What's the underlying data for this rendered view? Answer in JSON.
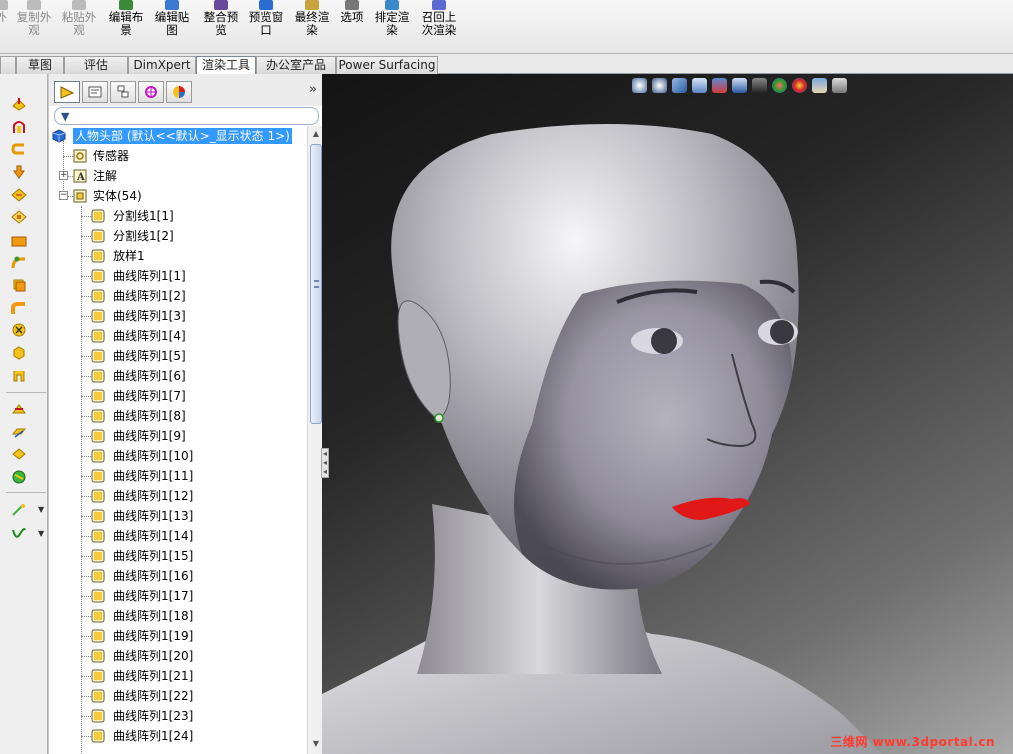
{
  "ribbon": {
    "buttons": [
      {
        "label": "外",
        "disabled": true,
        "icon": "edge-icon"
      },
      {
        "label": "复制外\n观",
        "disabled": true,
        "icon": "copy-appearance-icon"
      },
      {
        "label": "粘贴外\n观",
        "disabled": true,
        "icon": "paste-appearance-icon"
      },
      {
        "label": "编辑布\n景",
        "disabled": false,
        "icon": "edit-scene-icon"
      },
      {
        "label": "编辑贴\n图",
        "disabled": false,
        "icon": "edit-decal-icon"
      },
      {
        "label": "整合预\n览",
        "disabled": false,
        "icon": "integrated-preview-icon"
      },
      {
        "label": "预览窗\n口",
        "disabled": false,
        "icon": "preview-window-icon"
      },
      {
        "label": "最终渲\n染",
        "disabled": false,
        "icon": "final-render-icon"
      },
      {
        "label": "选项",
        "disabled": false,
        "icon": "options-icon"
      },
      {
        "label": "排定渲\n染",
        "disabled": false,
        "icon": "schedule-render-icon"
      },
      {
        "label": "召回上\n次渲染",
        "disabled": false,
        "icon": "recall-render-icon"
      }
    ]
  },
  "tabs": [
    "",
    "草图",
    "评估",
    "DimXpert",
    "渲染工具",
    "办公室产品",
    "Power Surfacing"
  ],
  "active_tab": "渲染工具",
  "tree": {
    "root": "人物头部 (默认<<默认>_显示状态 1>)",
    "sensors": "传感器",
    "annotations": "注解",
    "solid_bodies": "实体(54)",
    "bodies": [
      "分割线1[1]",
      "分割线1[2]",
      "放样1",
      "曲线阵列1[1]",
      "曲线阵列1[2]",
      "曲线阵列1[3]",
      "曲线阵列1[4]",
      "曲线阵列1[5]",
      "曲线阵列1[6]",
      "曲线阵列1[7]",
      "曲线阵列1[8]",
      "曲线阵列1[9]",
      "曲线阵列1[10]",
      "曲线阵列1[11]",
      "曲线阵列1[12]",
      "曲线阵列1[13]",
      "曲线阵列1[14]",
      "曲线阵列1[15]",
      "曲线阵列1[16]",
      "曲线阵列1[17]",
      "曲线阵列1[18]",
      "曲线阵列1[19]",
      "曲线阵列1[20]",
      "曲线阵列1[21]",
      "曲线阵列1[22]",
      "曲线阵列1[23]",
      "曲线阵列1[24]"
    ]
  },
  "collapse_glyph": "»",
  "watermark": "三维网 www.3dportal.cn",
  "colors": {
    "selection": "#3399ff",
    "folder": "#f5c93a",
    "skin": "#b9b7be",
    "lips": "#e01818",
    "watermark": "#ff3b30"
  }
}
